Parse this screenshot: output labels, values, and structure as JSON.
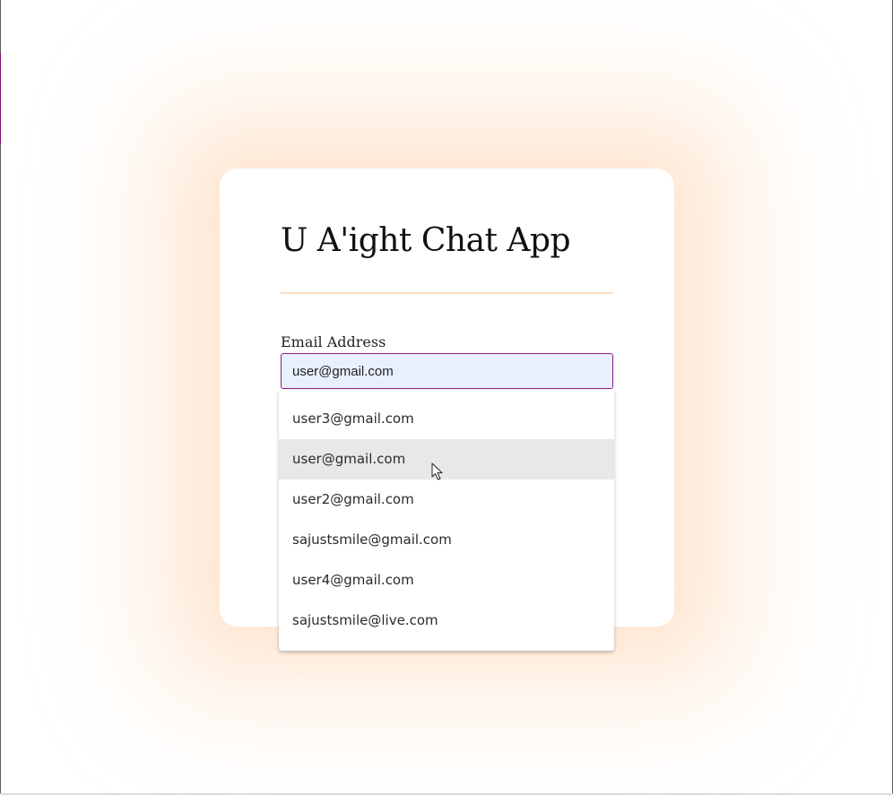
{
  "app": {
    "title": "U A'ight Chat App"
  },
  "form": {
    "email_label": "Email Address",
    "email_value": "user@gmail.com"
  },
  "autocomplete": {
    "hovered_index": 1,
    "options": [
      "user3@gmail.com",
      "user@gmail.com",
      "user2@gmail.com",
      "sajustsmile@gmail.com",
      "user4@gmail.com",
      "sajustsmile@live.com"
    ]
  },
  "theme": {
    "input_border": "#8a1a86",
    "input_fill": "#e8f0fe",
    "divider": "#f7dcc4",
    "glow": "#ffc496",
    "hover": "#e8e8e8"
  },
  "icons": {
    "cursor": "mouse-pointer-icon"
  }
}
